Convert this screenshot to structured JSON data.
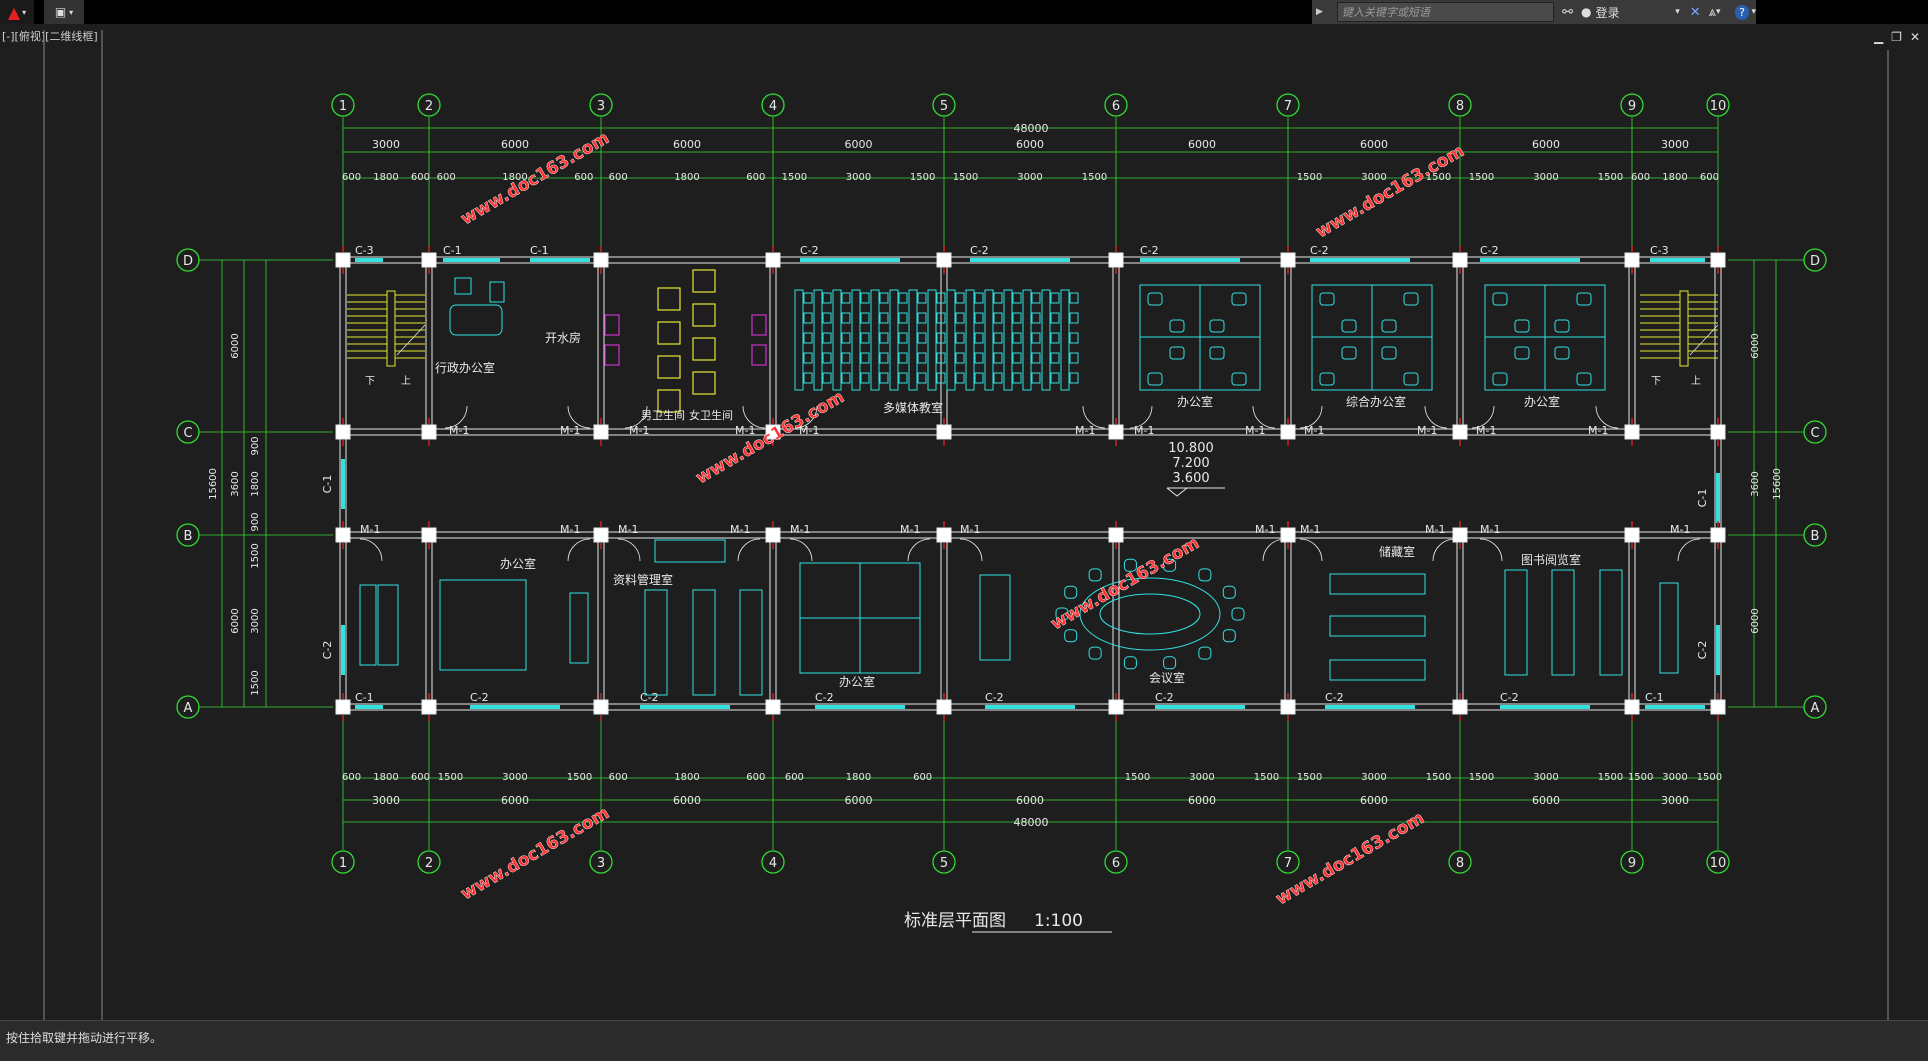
{
  "toolbar": {
    "search_placeholder": "键入关键字或短语",
    "login_label": "登录"
  },
  "viewport_label": "[-][俯视][二维线框]",
  "status_text": "按住拾取键并拖动进行平移。",
  "drawing": {
    "title": "标准层平面图",
    "scale": "1:100",
    "watermark": "www.doc163.com",
    "axes_numbers": [
      "1",
      "2",
      "3",
      "4",
      "5",
      "6",
      "7",
      "8",
      "9",
      "10"
    ],
    "axes_letters": [
      "D",
      "C",
      "B",
      "A"
    ],
    "overall_dim": "48000",
    "top_dims_row1": [
      "3000",
      "6000",
      "6000",
      "6000",
      "6000",
      "6000",
      "6000",
      "6000",
      "3000"
    ],
    "top_dims_row2": [
      "600",
      "1800",
      "600",
      "600",
      "1800",
      "600",
      "600",
      "1800",
      "600",
      "1500",
      "3000",
      "1500",
      "1500",
      "3000",
      "1500",
      "1500",
      "3000",
      "1500",
      "1500",
      "3000",
      "1500",
      "600",
      "1800",
      "600"
    ],
    "bottom_dims_row1": [
      "3000",
      "6000",
      "6000",
      "6000",
      "6000",
      "6000",
      "6000",
      "6000",
      "3000"
    ],
    "bottom_dims_row2": [
      "600",
      "1800",
      "600",
      "1500",
      "3000",
      "1500",
      "600",
      "1800",
      "600",
      "600",
      "1800",
      "600",
      "1500",
      "3000",
      "1500",
      "1500",
      "3000",
      "1500",
      "1500",
      "3000",
      "1500",
      "1500",
      "3000",
      "1500",
      "600",
      "1800",
      "600"
    ],
    "left_dims": [
      "6000",
      "3600",
      "6000",
      "15600",
      "900",
      "1800",
      "900",
      "1500",
      "3000",
      "1500"
    ],
    "right_dims": [
      "6000",
      "3600",
      "6000",
      "15600"
    ],
    "elevations": [
      "10.800",
      "7.200",
      "3.600"
    ],
    "rooms": {
      "admin_office": "行政办公室",
      "boiler_room": "开水房",
      "mens_wc": "男卫生间",
      "womens_wc": "女卫生间",
      "multimedia": "多媒体教室",
      "office": "办公室",
      "general_office": "综合办公室",
      "archives": "资料管理室",
      "meeting": "会议室",
      "storage": "储藏室",
      "reading": "图书阅览室",
      "stair_down": "下",
      "stair_up": "上"
    },
    "door_label": "M-1",
    "window_labels": [
      "C-1",
      "C-2",
      "C-3"
    ]
  },
  "colors": {
    "background": "#1e1e1e",
    "axis_green": "#33dd33",
    "furniture_cyan": "#33e0e0",
    "wall_white": "#e8e8e8",
    "watermark_red": "#ff3030",
    "stair_yellow": "#e6e633",
    "fixture_magenta": "#cc33cc",
    "column_red": "#cc2222"
  }
}
